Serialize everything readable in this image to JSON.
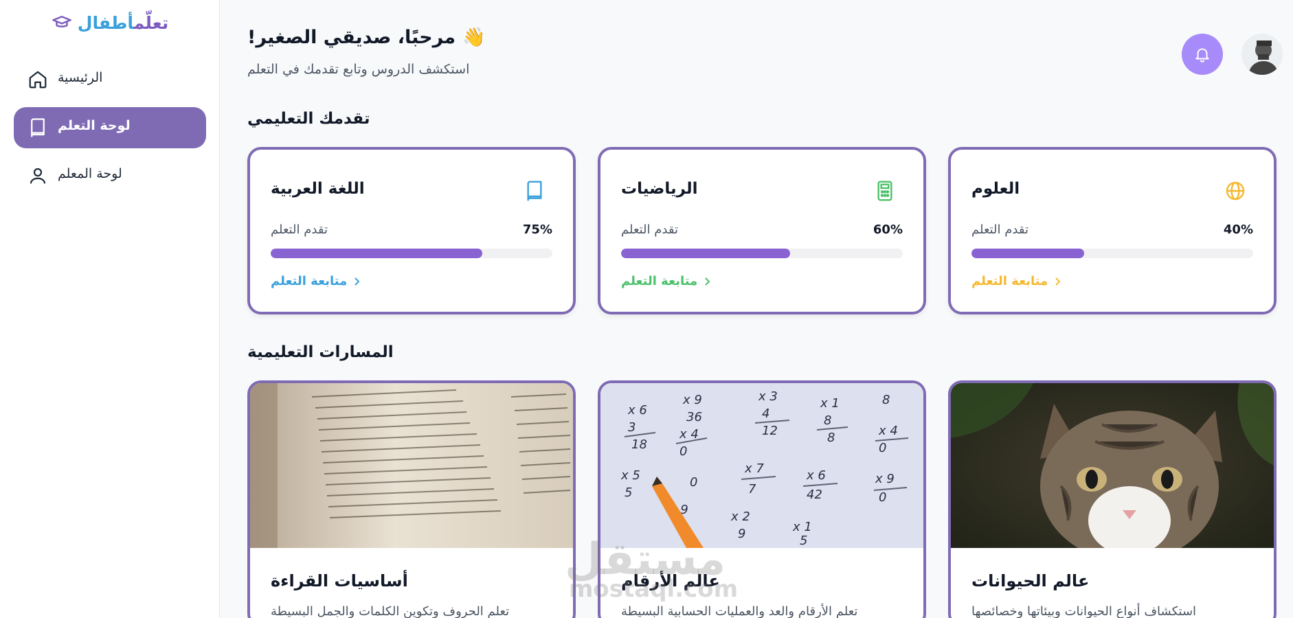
{
  "brand": {
    "part1": "تعلّم",
    "part2": "أطفال",
    "icon": "graduation-cap-icon"
  },
  "sidebar": {
    "items": [
      {
        "label": "الرئيسية",
        "icon": "home-icon",
        "active": false
      },
      {
        "label": "لوحة التعلم",
        "icon": "book-icon",
        "active": true
      },
      {
        "label": "لوحة المعلم",
        "icon": "user-icon",
        "active": false
      }
    ]
  },
  "header": {
    "title": "!مرحبًا، صديقي الصغير",
    "emoji": "👋",
    "subtitle": "استكشف الدروس وتابع تقدمك في التعلم",
    "bell_icon": "bell-icon",
    "avatar": "user-avatar"
  },
  "progress_section": {
    "title": "تقدمك التعليمي",
    "cards": [
      {
        "subject": "اللغة العربية",
        "icon": "book-icon",
        "icon_color": "#3aa0dc",
        "progress_label": "تقدم التعلم",
        "percent_text": "75%",
        "percent": 75,
        "link": "متابعة التعلم",
        "link_color": "#3aa0dc"
      },
      {
        "subject": "الرياضيات",
        "icon": "calculator-icon",
        "icon_color": "#4cc06a",
        "progress_label": "تقدم التعلم",
        "percent_text": "60%",
        "percent": 60,
        "link": "متابعة التعلم",
        "link_color": "#4cc06a"
      },
      {
        "subject": "العلوم",
        "icon": "globe-icon",
        "icon_color": "#f5b82e",
        "progress_label": "تقدم التعلم",
        "percent_text": "40%",
        "percent": 40,
        "link": "متابعة التعلم",
        "link_color": "#f5b82e"
      }
    ]
  },
  "paths_section": {
    "title": "المسارات التعليمية",
    "paths": [
      {
        "title": "أساسيات القراءة",
        "description": "تعلم الحروف وتكوين الكلمات والجمل البسيطة",
        "image": "dictionary-photo"
      },
      {
        "title": "عالم الأرقام",
        "description": "تعلم الأرقام والعد والعمليات الحسابية البسيطة",
        "image": "math-worksheet-photo"
      },
      {
        "title": "عالم الحيوانات",
        "description": "استكشاف أنواع الحيوانات وبيئاتها وخصائصها",
        "image": "kitten-photo"
      }
    ]
  },
  "watermark": {
    "text": "مستقل",
    "sub": "mostaql.com"
  },
  "colors": {
    "accent": "#7f6bb4",
    "bar": "#8a63d2",
    "bell": "#a78bfa"
  }
}
